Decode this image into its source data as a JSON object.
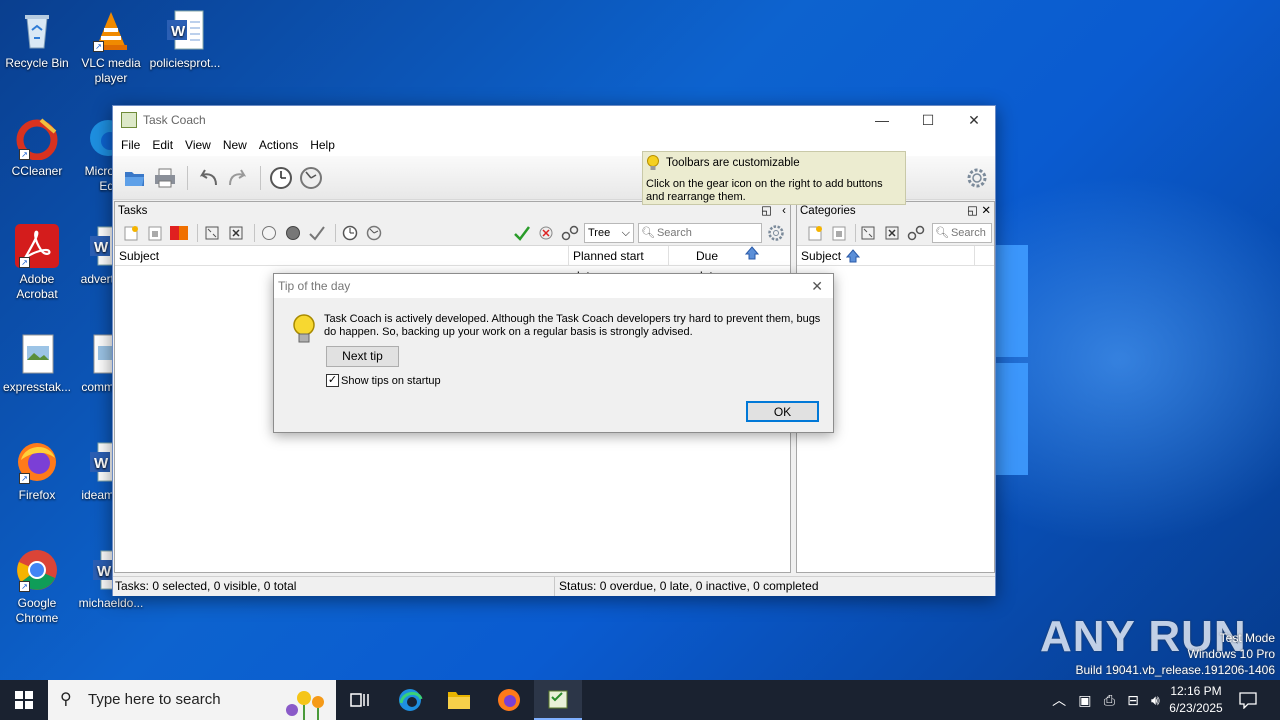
{
  "desktop": {
    "icons": [
      {
        "label": "Recycle Bin",
        "icon": "recycle-bin-icon"
      },
      {
        "label": "VLC media player",
        "icon": "vlc-icon"
      },
      {
        "label": "policiesprot...",
        "icon": "word-doc-icon"
      },
      {
        "label": "CCleaner",
        "icon": "ccleaner-icon"
      },
      {
        "label": "Micro Ed",
        "icon": "edge-icon"
      },
      {
        "label": "Adobe Acrobat",
        "icon": "acrobat-icon"
      },
      {
        "label": "advert",
        "icon": "word-doc-icon"
      },
      {
        "label": "expresstak...",
        "icon": "image-file-icon"
      },
      {
        "label": "comm",
        "icon": "image-file-icon"
      },
      {
        "label": "Firefox",
        "icon": "firefox-icon"
      },
      {
        "label": "ideam",
        "icon": "word-doc-icon"
      },
      {
        "label": "Google Chrome",
        "icon": "chrome-icon"
      },
      {
        "label": "michaeldo...",
        "icon": "word-doc-icon"
      }
    ]
  },
  "window": {
    "title": "Task Coach",
    "controls": {
      "minimize": "—",
      "maximize": "☐",
      "close": "✕"
    },
    "menu": [
      "File",
      "Edit",
      "View",
      "New",
      "Actions",
      "Help"
    ]
  },
  "tooltip": {
    "title": "Toolbars are customizable",
    "body": "Click on the gear icon on the right to add buttons and rearrange them."
  },
  "tasks_pane": {
    "title": "Tasks",
    "view_mode": "Tree",
    "search_placeholder": "Search",
    "columns": [
      "Subject",
      "Planned start date",
      "Due date"
    ]
  },
  "categories_pane": {
    "title": "Categories",
    "search_placeholder": "Search",
    "columns": [
      "Subject"
    ]
  },
  "status": {
    "left": "Tasks: 0 selected, 0 visible, 0 total",
    "right": "Status: 0 overdue, 0 late, 0 inactive, 0 completed"
  },
  "dialog": {
    "title": "Tip of the day",
    "message": "Task Coach is actively developed. Although the Task Coach developers try hard to prevent them, bugs do happen. So, backing up your work on a regular basis is strongly advised.",
    "next_tip": "Next tip",
    "show_tips_label": "Show tips on startup",
    "show_tips_checked": true,
    "ok": "OK",
    "close": "✕"
  },
  "taskbar": {
    "search_placeholder": "Type here to search",
    "time": "12:16 PM",
    "date": "6/23/2025"
  },
  "watermark": {
    "brand": "ANY RUN",
    "line1": "Test Mode",
    "line2": "Windows 10 Pro",
    "line3": "Build 19041.vb_release.191206-1406"
  },
  "colors": {
    "desktop_blue": "#0d63cf",
    "tooltip_bg": "#ececd0",
    "taskbar": "#1a2230"
  }
}
